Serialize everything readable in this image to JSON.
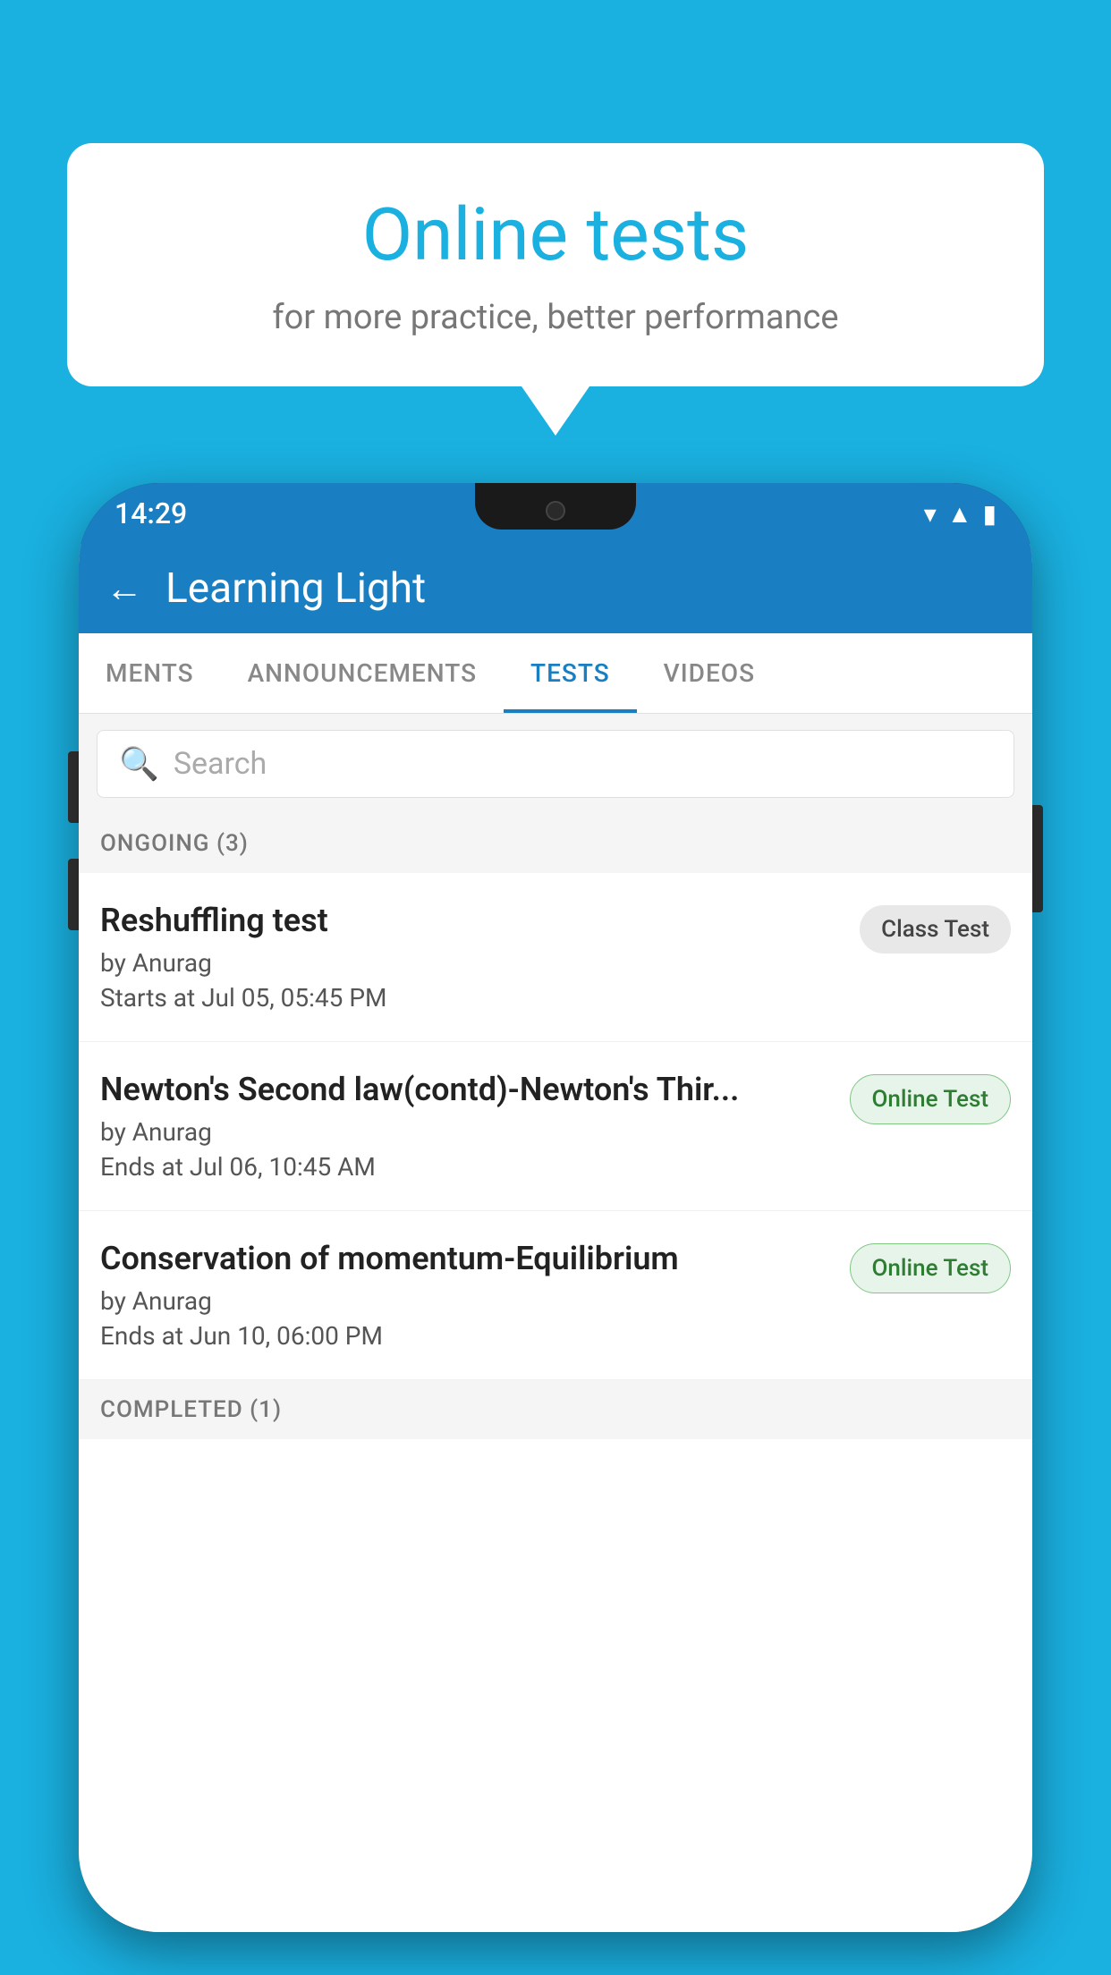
{
  "background_color": "#1ab0e0",
  "speech_bubble": {
    "title": "Online tests",
    "subtitle": "for more practice, better performance"
  },
  "phone": {
    "status_bar": {
      "time": "14:29",
      "icons": [
        "wifi",
        "signal",
        "battery"
      ]
    },
    "app_bar": {
      "title": "Learning Light",
      "back_label": "←"
    },
    "tabs": [
      {
        "label": "MENTS",
        "active": false
      },
      {
        "label": "ANNOUNCEMENTS",
        "active": false
      },
      {
        "label": "TESTS",
        "active": true
      },
      {
        "label": "VIDEOS",
        "active": false
      }
    ],
    "search": {
      "placeholder": "Search"
    },
    "sections": [
      {
        "header": "ONGOING (3)",
        "items": [
          {
            "title": "Reshuffling test",
            "author": "by Anurag",
            "date": "Starts at  Jul 05, 05:45 PM",
            "badge": "Class Test",
            "badge_type": "class"
          },
          {
            "title": "Newton's Second law(contd)-Newton's Thir...",
            "author": "by Anurag",
            "date": "Ends at  Jul 06, 10:45 AM",
            "badge": "Online Test",
            "badge_type": "online"
          },
          {
            "title": "Conservation of momentum-Equilibrium",
            "author": "by Anurag",
            "date": "Ends at  Jun 10, 06:00 PM",
            "badge": "Online Test",
            "badge_type": "online"
          }
        ]
      }
    ],
    "completed_header": "COMPLETED (1)"
  }
}
